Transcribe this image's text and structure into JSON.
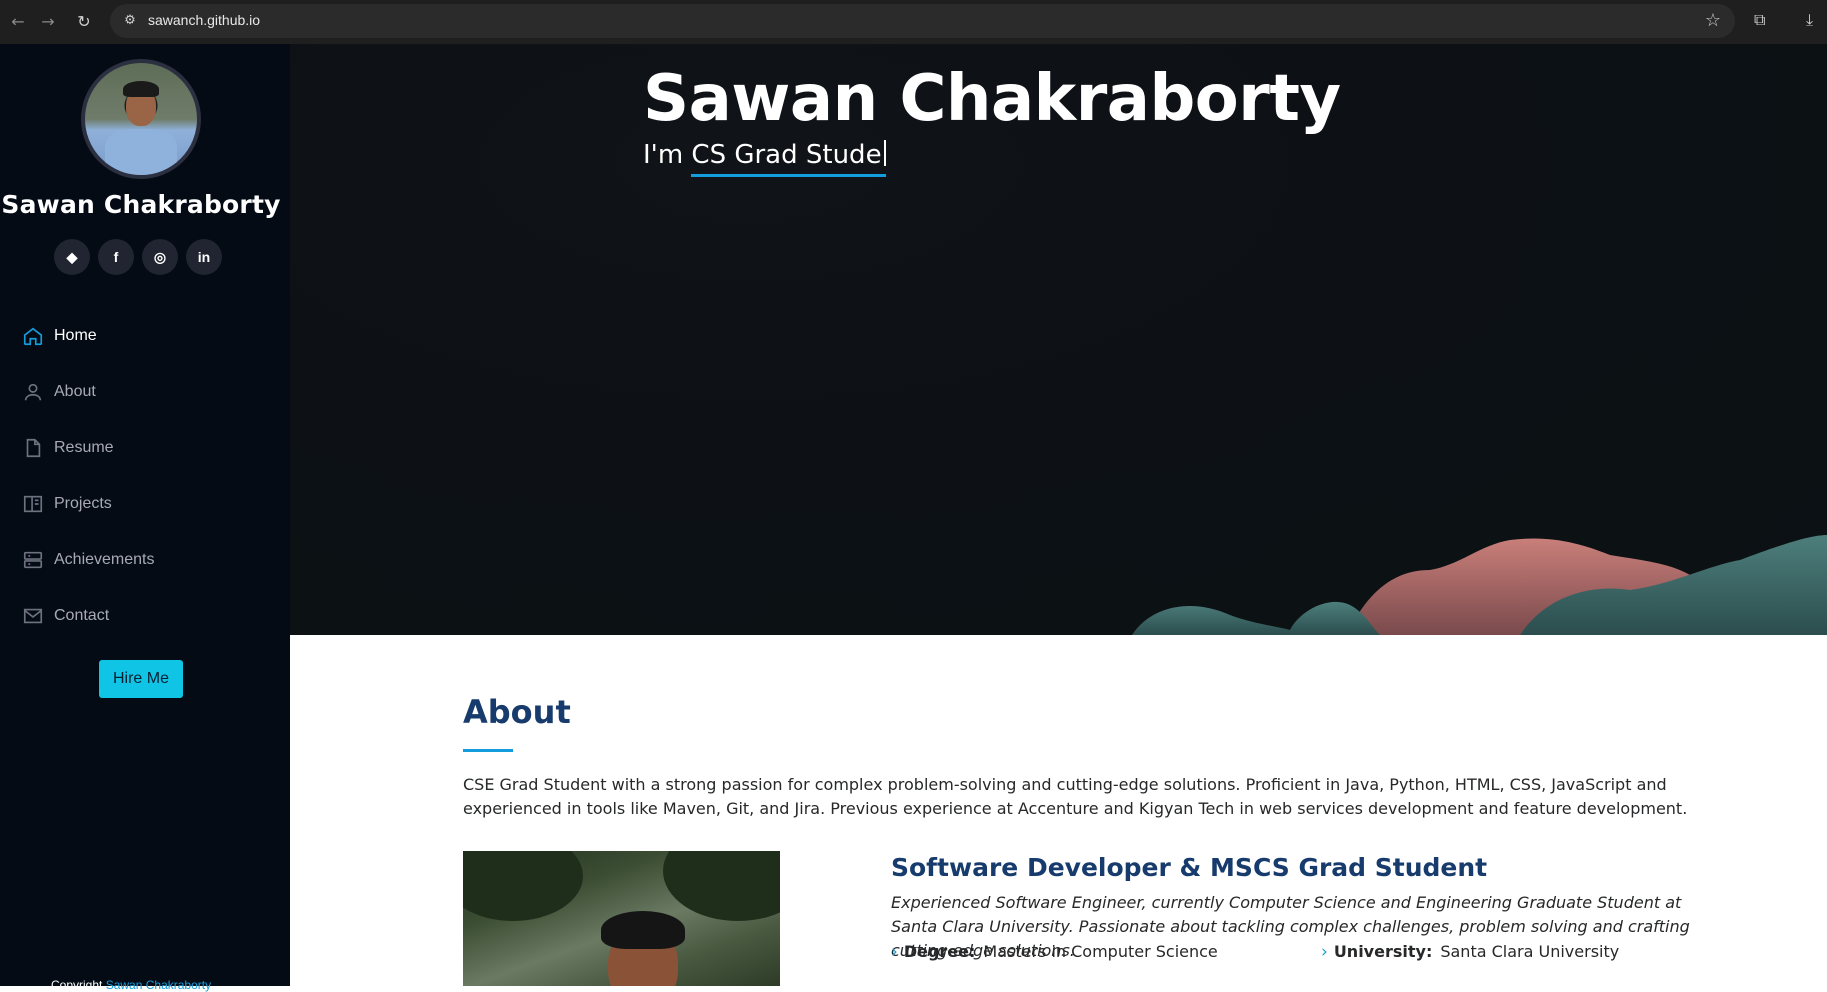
{
  "browser": {
    "url": "sawanch.github.io",
    "back_icon": "back-arrow-icon",
    "forward_icon": "forward-arrow-icon",
    "reload_icon": "reload-icon"
  },
  "sidebar": {
    "name": "Sawan Chakraborty",
    "socials": [
      {
        "icon": "git-icon",
        "glyph": "◆"
      },
      {
        "icon": "facebook-icon",
        "glyph": "f"
      },
      {
        "icon": "instagram-icon",
        "glyph": "◎"
      },
      {
        "icon": "linkedin-icon",
        "glyph": "in"
      }
    ],
    "nav": [
      {
        "label": "Home",
        "icon": "home-icon",
        "active": true
      },
      {
        "label": "About",
        "icon": "person-icon",
        "active": false
      },
      {
        "label": "Resume",
        "icon": "file-icon",
        "active": false
      },
      {
        "label": "Projects",
        "icon": "book-icon",
        "active": false
      },
      {
        "label": "Achievements",
        "icon": "server-icon",
        "active": false
      },
      {
        "label": "Contact",
        "icon": "envelope-icon",
        "active": false
      }
    ],
    "hire_label": "Hire Me",
    "copyright_prefix": "Copyright",
    "copyright_link": "Sawan Chakraborty"
  },
  "hero": {
    "title": "Sawan Chakraborty",
    "prefix": "I'm",
    "typed": "CS Grad Stude"
  },
  "about": {
    "title": "About",
    "text": "CSE Grad Student with a strong passion for complex problem-solving and cutting-edge solutions. Proficient in Java, Python, HTML, CSS, JavaScript and experienced in tools like Maven, Git, and Jira. Previous experience at Accenture and Kigyan Tech in web services development and feature development.",
    "role_title": "Software Developer & MSCS Grad Student",
    "role_desc": "Experienced Software Engineer, currently Computer Science and Engineering Graduate Student at Santa Clara University. Passionate about tackling complex challenges, problem solving and crafting cutting-edge solutions.",
    "facts": [
      {
        "label": "Degree:",
        "value": "Masters in Computer Science"
      },
      {
        "label": "University:",
        "value": "Santa Clara University"
      }
    ]
  },
  "colors": {
    "accent": "#149ddd",
    "sidebar_bg": "#040b14",
    "heading": "#173b6c",
    "hire_bg": "#10c4e6"
  }
}
